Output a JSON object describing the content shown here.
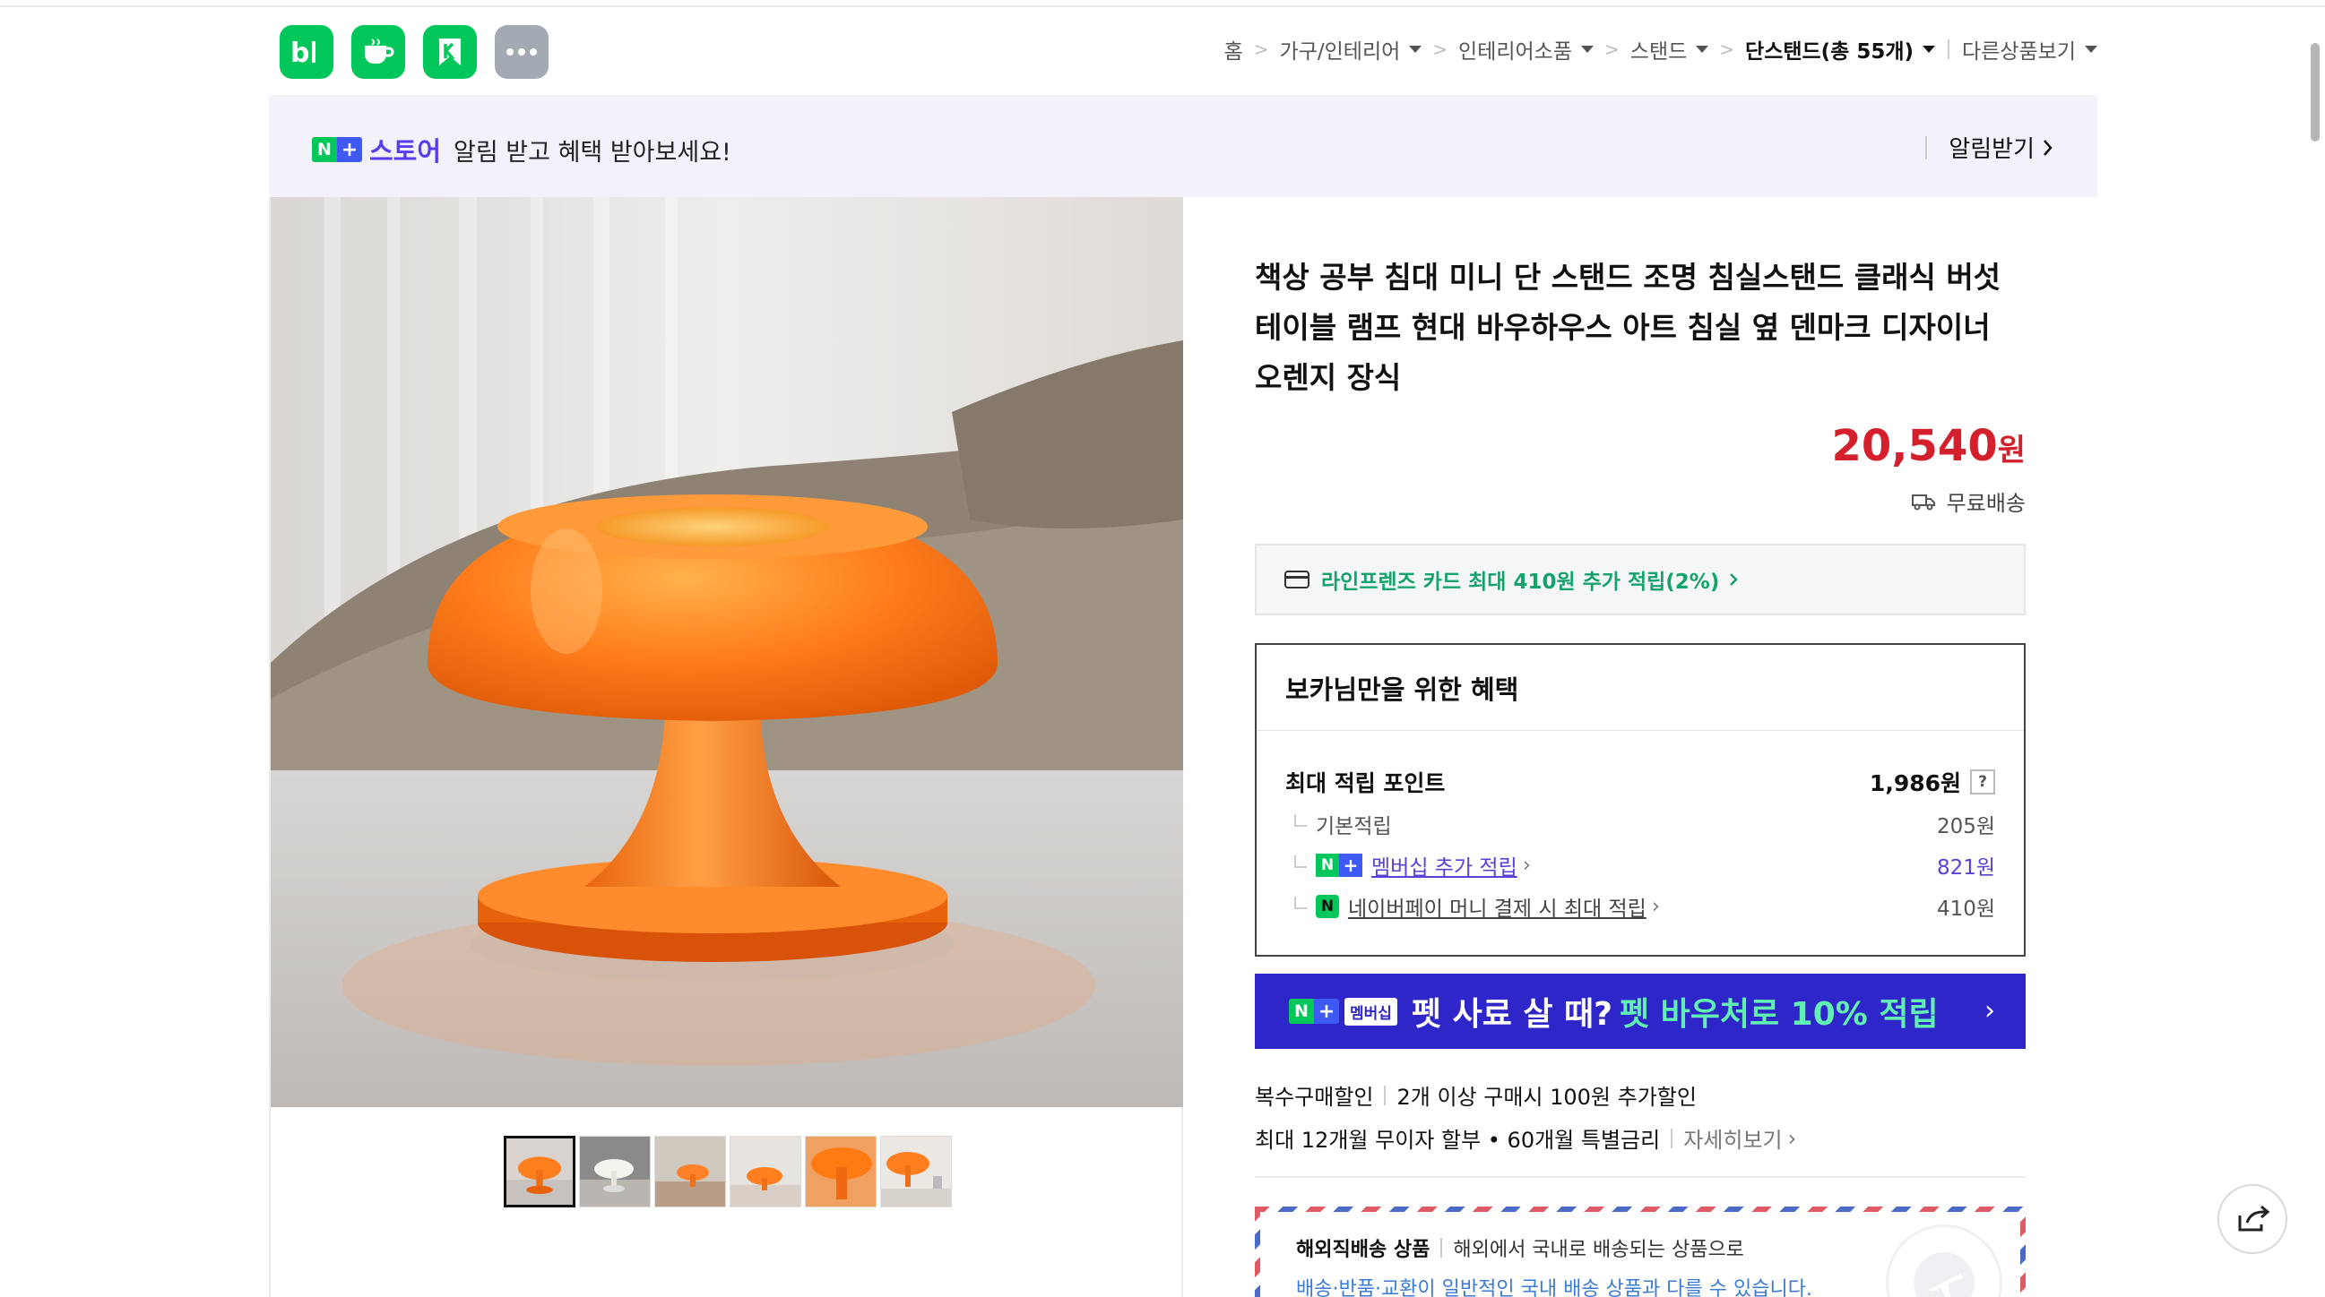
{
  "apps": [
    {
      "name": "blog",
      "icon": "blog-icon",
      "label": "b|"
    },
    {
      "name": "cafe",
      "icon": "cafe-icon"
    },
    {
      "name": "bookmark",
      "icon": "bookmark-icon"
    },
    {
      "name": "more",
      "icon": "more-dots-icon"
    }
  ],
  "breadcrumb": {
    "home": "홈",
    "c1": "가구/인테리어",
    "c2": "인테리어소품",
    "c3": "스탠드",
    "c4": "단스탠드(총 55개)",
    "other": "다른상품보기"
  },
  "store_banner": {
    "n_badge": "N",
    "plus_badge": "+",
    "store_word": "스토어",
    "text": "알림 받고 혜택 받아보세요!",
    "cta": "알림받기"
  },
  "product": {
    "title": "책상 공부 침대 미니 단 스탠드 조명 침실스탠드 클래식 버섯 테이블 램프 현대 바우하우스 아트 침실 옆 덴마크 디자이너 오렌지 장식",
    "price": "20,540",
    "price_unit": "원",
    "shipping": "무료배송"
  },
  "card_offer": "라인프렌즈 카드 최대 410원 추가 적립(2%)",
  "benefit": {
    "title": "보카님만을 위한 혜택",
    "max_label": "최대 적립 포인트",
    "max_value": "1,986원",
    "q": "?",
    "base_label": "기본적립",
    "base_value": "205원",
    "membership_label": "멤버십 추가 적립",
    "membership_value": "821원",
    "pay_label": "네이버페이 머니 결제 시 최대 적립",
    "pay_value": "410원"
  },
  "promo": {
    "member_badge": "멤버십",
    "text1": "펫 사료 살 때?",
    "text2": "펫 바우처로 10% 적립",
    "arrow": "›"
  },
  "discount": {
    "label": "복수구매할인",
    "text": "2개 이상 구매시 100원 추가할인"
  },
  "installment": {
    "text": "최대 12개월 무이자 할부 • 60개월 특별금리",
    "link": "자세히보기"
  },
  "overseas": {
    "title": "해외직배송 상품",
    "desc": "해외에서 국내로 배송되는 상품으로",
    "note": "배송·반품·교환이 일반적인 국내 배송 상품과 다를 수 있습니다."
  },
  "thumbnails": [
    "orange-lamp",
    "white-lamp-room",
    "orange-lamp-room",
    "orange-lamp-bed",
    "orange-lamp-closeup",
    "orange-lamp-desk"
  ],
  "colors": {
    "naver_green": "#03c75a",
    "price_red": "#d3202c",
    "promo_blue": "#2f26c9",
    "store_purple": "#5a3cf0",
    "lamp_orange": "#ff7a1a"
  }
}
